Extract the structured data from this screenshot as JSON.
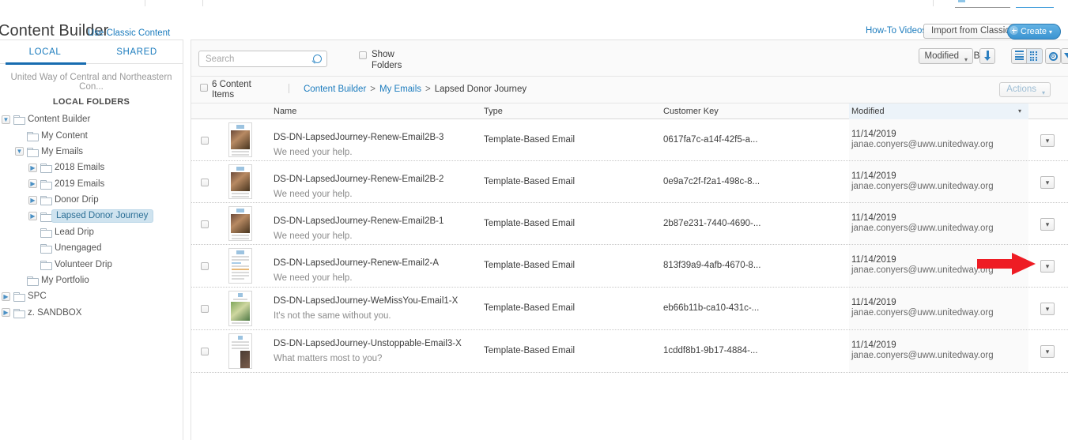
{
  "header": {
    "title": "Content Builder",
    "classic_link": "Use Classic Content",
    "howto_link": "How-To Videos",
    "import_button": "Import from Classic",
    "create_button": "Create",
    "create_caret": "▾"
  },
  "sidebar": {
    "tabs": [
      {
        "label": "LOCAL",
        "active": true
      },
      {
        "label": "SHARED",
        "active": false
      }
    ],
    "account_name": "United Way of Central and Northeastern Con...",
    "section_label": "LOCAL FOLDERS",
    "tree": [
      {
        "label": "Content Builder",
        "indent": 0,
        "twist": "open",
        "selected": false
      },
      {
        "label": "My Content",
        "indent": 1,
        "twist": "none",
        "selected": false
      },
      {
        "label": "My Emails",
        "indent": 1,
        "twist": "open",
        "selected": false
      },
      {
        "label": "2018 Emails",
        "indent": 2,
        "twist": "closed",
        "selected": false
      },
      {
        "label": "2019 Emails",
        "indent": 2,
        "twist": "closed",
        "selected": false
      },
      {
        "label": "Donor Drip",
        "indent": 2,
        "twist": "closed",
        "selected": false
      },
      {
        "label": "Lapsed Donor Journey",
        "indent": 2,
        "twist": "closed",
        "selected": true
      },
      {
        "label": "Lead Drip",
        "indent": 2,
        "twist": "none",
        "selected": false
      },
      {
        "label": "Unengaged",
        "indent": 2,
        "twist": "none",
        "selected": false
      },
      {
        "label": "Volunteer Drip",
        "indent": 2,
        "twist": "none",
        "selected": false
      },
      {
        "label": "My Portfolio",
        "indent": 1,
        "twist": "none",
        "selected": false
      },
      {
        "label": "SPC",
        "indent": 0,
        "twist": "closed",
        "selected": false
      },
      {
        "label": "z. SANDBOX",
        "indent": 0,
        "twist": "closed",
        "selected": false
      }
    ]
  },
  "toolbar": {
    "search_placeholder": "Search",
    "search_value": "",
    "show_folders_label_line1": "Show",
    "show_folders_label_line2": "Folders",
    "show_folders_checked": false,
    "sort_by_label": "Sort By",
    "sort_by_value": "Modified",
    "sort_caret": "▾",
    "icons": [
      "sort-direction-icon",
      "list-view-icon",
      "grid-view-icon",
      "gear-icon",
      "filter-icon"
    ],
    "active_view": "grid-view-icon"
  },
  "crumbbar": {
    "select_all_checked": false,
    "item_count_line1": "6 Content",
    "item_count_line2": "Items",
    "breadcrumb": [
      {
        "label": "Content Builder",
        "link": true
      },
      {
        "label": "My Emails",
        "link": true
      },
      {
        "label": "Lapsed Donor Journey",
        "link": false
      }
    ],
    "breadcrumb_separator": ">",
    "actions_button": "Actions",
    "actions_caret": "▾"
  },
  "table": {
    "columns": [
      "Name",
      "Type",
      "Customer Key",
      "Modified"
    ],
    "sorted_column": "Modified",
    "sort_direction_caret": "▾",
    "rows": [
      {
        "name": "DS-DN-LapsedJourney-Renew-Email2B-3",
        "subtitle": "We need your help.",
        "type": "Template-Based Email",
        "customer_key": "0617fa7c-a14f-42f5-a...",
        "modified_date": "11/14/2019",
        "modified_by": "janae.conyers@uww.unitedway.org",
        "thumb": "renew",
        "row_menu_caret": "▾",
        "checked": false,
        "annotated": false
      },
      {
        "name": "DS-DN-LapsedJourney-Renew-Email2B-2",
        "subtitle": "We need your help.",
        "type": "Template-Based Email",
        "customer_key": "0e9a7c2f-f2a1-498c-8...",
        "modified_date": "11/14/2019",
        "modified_by": "janae.conyers@uww.unitedway.org",
        "thumb": "renew",
        "row_menu_caret": "▾",
        "checked": false,
        "annotated": false
      },
      {
        "name": "DS-DN-LapsedJourney-Renew-Email2B-1",
        "subtitle": "We need your help.",
        "type": "Template-Based Email",
        "customer_key": "2b87e231-7440-4690-...",
        "modified_date": "11/14/2019",
        "modified_by": "janae.conyers@uww.unitedway.org",
        "thumb": "renew",
        "row_menu_caret": "▾",
        "checked": false,
        "annotated": false
      },
      {
        "name": "DS-DN-LapsedJourney-Renew-Email2-A",
        "subtitle": "We need your help.",
        "type": "Template-Based Email",
        "customer_key": "813f39a9-4afb-4670-8...",
        "modified_date": "11/14/2019",
        "modified_by": "janae.conyers@uww.unitedway.org",
        "thumb": "text",
        "row_menu_caret": "▾",
        "checked": false,
        "annotated": true
      },
      {
        "name": "DS-DN-LapsedJourney-WeMissYou-Email1-X",
        "subtitle": "It's not the same without you.",
        "type": "Template-Based Email",
        "customer_key": "eb66b11b-ca10-431c-...",
        "modified_date": "11/14/2019",
        "modified_by": "janae.conyers@uww.unitedway.org",
        "thumb": "group",
        "row_menu_caret": "▾",
        "checked": false,
        "annotated": false
      },
      {
        "name": "DS-DN-LapsedJourney-Unstoppable-Email3-X",
        "subtitle": "What matters most to you?",
        "type": "Template-Based Email",
        "customer_key": "1cddf8b1-9b17-4884-...",
        "modified_date": "11/14/2019",
        "modified_by": "janae.conyers@uww.unitedway.org",
        "thumb": "portrait",
        "row_menu_caret": "▾",
        "checked": false,
        "annotated": false
      }
    ]
  },
  "annotation": {
    "type": "red-arrow",
    "color": "#ee1c24",
    "points_to": "row-menu-button of row 4"
  },
  "colors": {
    "link": "#1c7cbe",
    "accent": "#176cb0",
    "selected_bg": "#cfe3ef",
    "annotation_red": "#ee1c24"
  }
}
